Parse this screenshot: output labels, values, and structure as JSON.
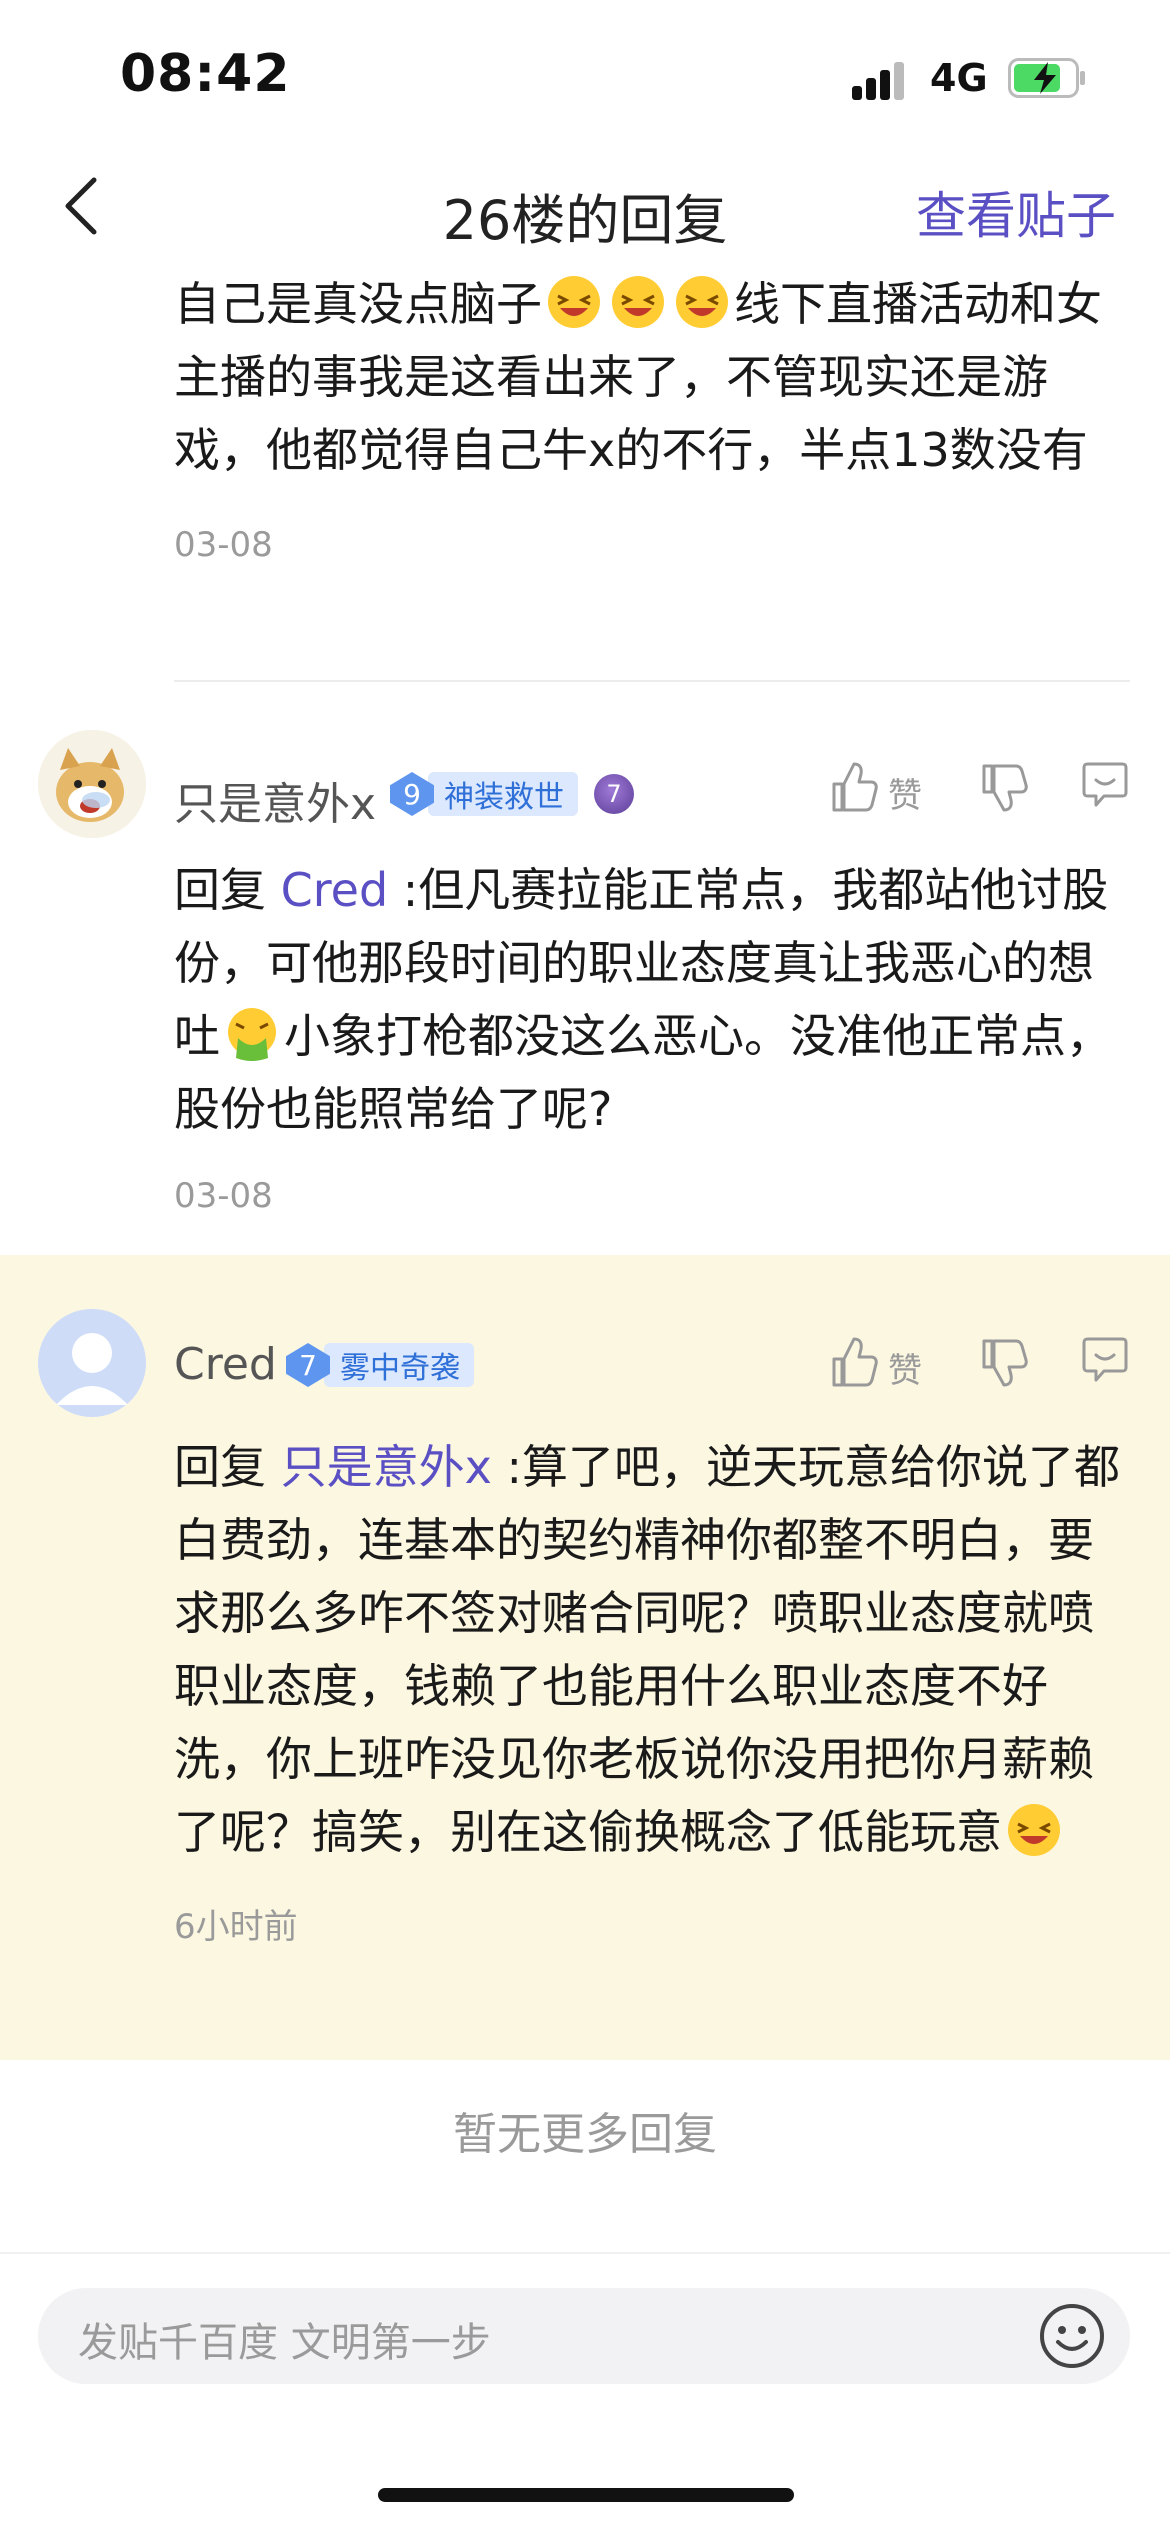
{
  "status": {
    "time": "08:42",
    "network": "4G"
  },
  "nav": {
    "title": "26楼的回复",
    "view_post": "查看贴子"
  },
  "top_comment": {
    "text_a": "自己是真没点脑子",
    "text_b": "线下直播活动和女主播的事我是这看出来了，不管现实还是游戏，他都觉得自己牛x的不行，半点13数没有",
    "date": "03-08"
  },
  "comments": [
    {
      "author": "只是意外x",
      "level": "9",
      "level_tag": "神装救世",
      "badge": "7",
      "reply_prefix": "回复 ",
      "reply_to": "Cred",
      "text_a": " :但凡赛拉能正常点，我都站他讨股份，可他那段时间的职业态度真让我恶心的想吐",
      "text_b": "小象打枪都没这么恶心。没准他正常点，股份也能照常给了呢?",
      "date": "03-08",
      "like_label": "赞"
    },
    {
      "author": "Cred",
      "level": "7",
      "level_tag": "雾中奇袭",
      "reply_prefix": "回复 ",
      "reply_to": "只是意外x",
      "text_a": " :算了吧，逆天玩意给你说了都白费劲，连基本的契约精神你都整不明白，要求那么多咋不签对赌合同呢？喷职业态度就喷职业态度，钱赖了也能用什么职业态度不好洗，你上班咋没见你老板说你没用把你月薪赖了呢？搞笑，别在这偷换概念了低能玩意",
      "date": "6小时前",
      "like_label": "赞"
    }
  ],
  "no_more": "暂无更多回复",
  "input": {
    "placeholder": "发贴千百度 文明第一步"
  },
  "colors": {
    "accent": "#5b4fc4",
    "highlight_bg": "#fcf7e1",
    "level_blue": "#5e96ef"
  },
  "icons": [
    "back-icon",
    "signal-icon",
    "battery-charging-icon",
    "thumbs-up-icon",
    "thumbs-down-icon",
    "reply-bubble-icon",
    "emoji-icon",
    "laughing-emoji",
    "vomit-emoji"
  ]
}
